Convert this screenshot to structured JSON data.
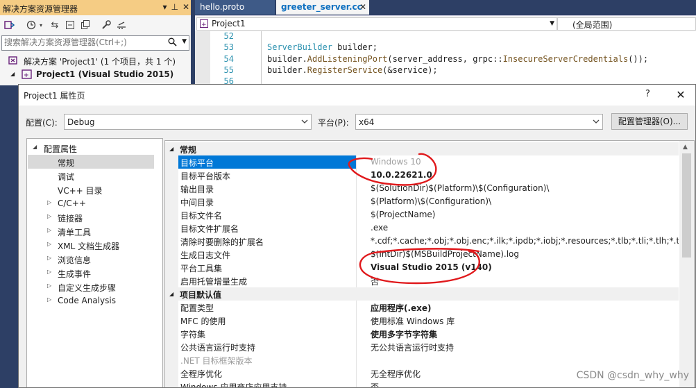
{
  "solution_explorer": {
    "title": "解决方案资源管理器",
    "title_buttons": [
      "▾",
      "⊥",
      "✕"
    ],
    "search_placeholder": "搜索解决方案资源管理器(Ctrl+;)",
    "tree": [
      {
        "label": "解决方案 'Project1' (1 个项目，共 1 个)"
      },
      {
        "label": "Project1 (Visual Studio 2015)"
      }
    ]
  },
  "editor": {
    "tabs": [
      {
        "label": "hello.proto"
      },
      {
        "label": "greeter_server.cc",
        "close": "✕"
      }
    ],
    "nav": {
      "project": "Project1",
      "scope": "(全局范围)"
    },
    "line_numbers": [
      "52",
      "53",
      "54",
      "55",
      "56"
    ],
    "code": {
      "line53_type": "ServerBuilder",
      "line53_rest": " builder;",
      "line54_a": "builder.",
      "line54_fn": "AddListeningPort",
      "line54_b": "(server_address, grpc::",
      "line54_fn2": "InsecureServerCredentials",
      "line54_c": "());",
      "line55_a": "builder.",
      "line55_fn": "RegisterService",
      "line55_b": "(&service);"
    }
  },
  "dialog": {
    "title": "Project1 属性页",
    "help": "?",
    "close": "✕",
    "config_label": "配置(C):",
    "config_value": "Debug",
    "platform_label": "平台(P):",
    "platform_value": "x64",
    "config_manager_button": "配置管理器(O)...",
    "nav_tree": [
      {
        "label": "配置属性",
        "arrow": "◢"
      },
      {
        "label": "常规"
      },
      {
        "label": "调试"
      },
      {
        "label": "VC++ 目录"
      },
      {
        "label": "C/C++",
        "arrow": "▷"
      },
      {
        "label": "链接器",
        "arrow": "▷"
      },
      {
        "label": "清单工具",
        "arrow": "▷"
      },
      {
        "label": "XML 文档生成器",
        "arrow": "▷"
      },
      {
        "label": "浏览信息",
        "arrow": "▷"
      },
      {
        "label": "生成事件",
        "arrow": "▷"
      },
      {
        "label": "自定义生成步骤",
        "arrow": "▷"
      },
      {
        "label": "Code Analysis",
        "arrow": "▷"
      }
    ],
    "grid": {
      "toggle": "◢",
      "cat_general": "常规",
      "cat_defaults": "项目默认值",
      "general_rows": [
        {
          "name": "目标平台",
          "value": "Windows 10"
        },
        {
          "name": "目标平台版本",
          "value": "10.0.22621.0"
        },
        {
          "name": "输出目录",
          "value": "$(SolutionDir)$(Platform)\\$(Configuration)\\"
        },
        {
          "name": "中间目录",
          "value": "$(Platform)\\$(Configuration)\\"
        },
        {
          "name": "目标文件名",
          "value": "$(ProjectName)"
        },
        {
          "name": "目标文件扩展名",
          "value": ".exe"
        },
        {
          "name": "清除时要删除的扩展名",
          "value": "*.cdf;*.cache;*.obj;*.obj.enc;*.ilk;*.ipdb;*.iobj;*.resources;*.tlb;*.tli;*.tlh;*.tmp;*.r"
        },
        {
          "name": "生成日志文件",
          "value": "$(IntDir)$(MSBuildProjectName).log"
        },
        {
          "name": "平台工具集",
          "value": "Visual Studio 2015 (v140)"
        },
        {
          "name": "启用托管增量生成",
          "value": "否"
        }
      ],
      "default_rows": [
        {
          "name": "配置类型",
          "value": "应用程序(.exe)"
        },
        {
          "name": "MFC 的使用",
          "value": "使用标准 Windows 库"
        },
        {
          "name": "字符集",
          "value": "使用多字节字符集"
        },
        {
          "name": "公共语言运行时支持",
          "value": "无公共语言运行时支持"
        },
        {
          "name": ".NET 目标框架版本",
          "value": ""
        },
        {
          "name": "全程序优化",
          "value": "无全程序优化"
        },
        {
          "name": "Windows 应用商店应用支持",
          "value": "否"
        }
      ]
    }
  },
  "watermark": "CSDN @csdn_why_why",
  "colors": {
    "selection": "#0078d7",
    "annotation": "#e0191c",
    "tab_active_text": "#0e70c0",
    "title_bar": "#f5cc84"
  }
}
